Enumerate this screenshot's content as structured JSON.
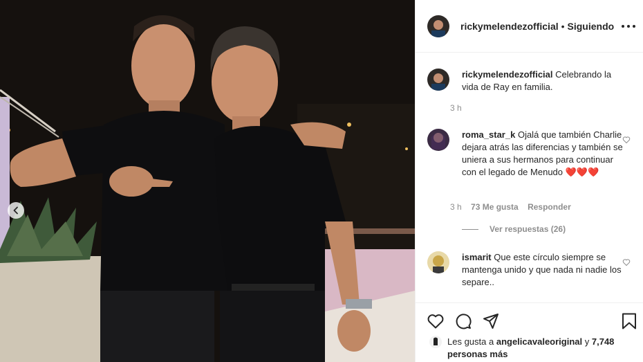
{
  "post": {
    "photo_alt": "Two men in black outfits posing together at night",
    "prev_icon": "chevron-left-icon"
  },
  "header": {
    "username": "rickymelendezofficial",
    "separator": "•",
    "follow_label": "Siguiendo",
    "more_icon": "more-options-icon"
  },
  "caption": {
    "username": "rickymelendezofficial",
    "text": "Celebrando la vida de Ray en familia.",
    "time": "3 h"
  },
  "comments": [
    {
      "username": "roma_star_k",
      "text": "Ojalá que también Charlie dejara atrás las diferencias y también se uniera a sus hermanos para continuar con el legado de Menudo ❤️❤️❤️",
      "time": "3 h",
      "likes": "73 Me gusta",
      "reply_label": "Responder",
      "view_replies": "Ver respuestas (26)"
    },
    {
      "username": "ismarit",
      "text": "Que este círculo siempre se mantenga unido y que nada ni nadie los separe..",
      "time": ""
    }
  ],
  "actions": {
    "like_icon": "heart-icon",
    "comment_icon": "comment-icon",
    "share_icon": "send-icon",
    "save_icon": "bookmark-icon"
  },
  "likes": {
    "prefix": "Les gusta a",
    "user": "angelicavaleoriginal",
    "conj": "y",
    "count": "7,748 personas más"
  },
  "colors": {
    "text": "#262626",
    "secondary": "#8e8e8e",
    "divider": "#efefef",
    "heart_red": "#ed4956"
  }
}
